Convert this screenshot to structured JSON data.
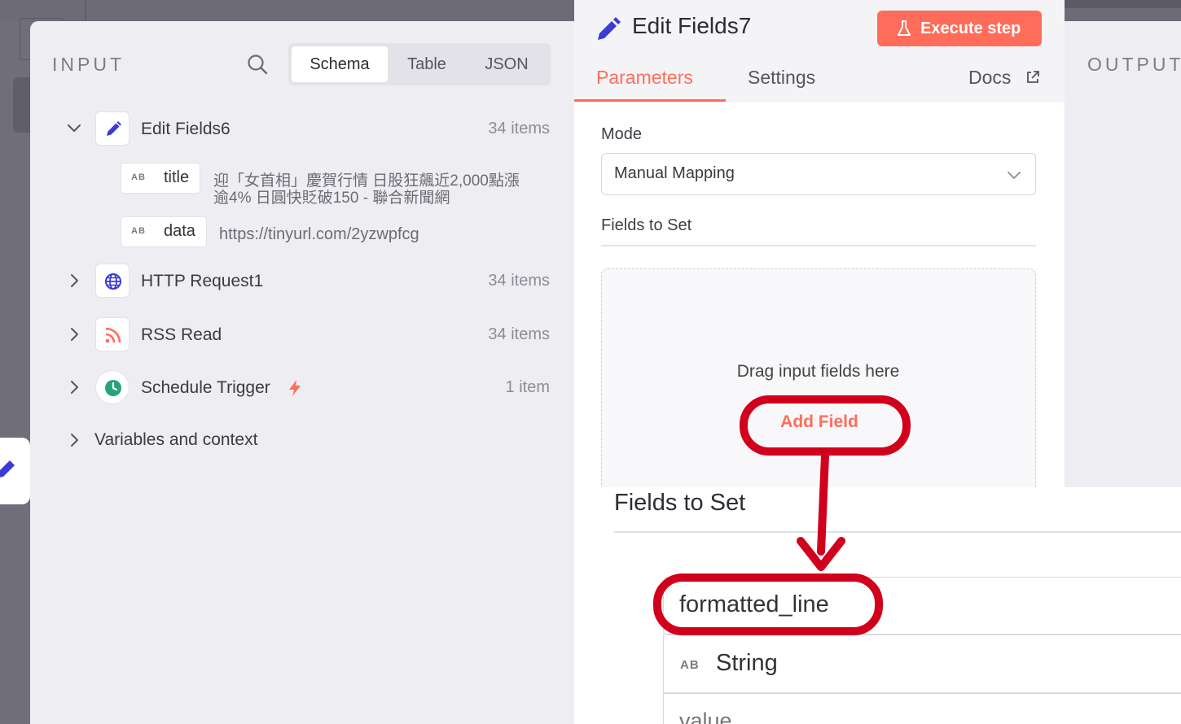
{
  "input": {
    "title": "INPUT",
    "view_tabs": [
      "Schema",
      "Table",
      "JSON"
    ],
    "active_view": "Schema",
    "nodes": [
      {
        "name": "Edit Fields6",
        "count": "34 items",
        "icon": "pencil-icon",
        "expanded": true
      },
      {
        "name": "HTTP Request1",
        "count": "34 items",
        "icon": "globe-icon",
        "expanded": false
      },
      {
        "name": "RSS Read",
        "count": "34 items",
        "icon": "rss-icon",
        "expanded": false
      },
      {
        "name": "Schedule Trigger",
        "count": "1 item",
        "icon": "clock-icon",
        "expanded": false
      }
    ],
    "fields": [
      {
        "type": "AB",
        "name": "title",
        "value_line1": "迎「女首相」慶賀行情 日股狂飆近2,000點漲",
        "value_line2": "逾4% 日圓快貶破150 - 聯合新聞網"
      },
      {
        "type": "AB",
        "name": "data",
        "value": "https://tinyurl.com/2yzwpfcg"
      }
    ],
    "variables_label": "Variables and context"
  },
  "node": {
    "title": "Edit Fields7",
    "execute_label": "Execute step",
    "tabs": [
      "Parameters",
      "Settings"
    ],
    "active_tab": "Parameters",
    "docs_label": "Docs",
    "mode_label": "Mode",
    "mode_value": "Manual Mapping",
    "fields_to_set_label": "Fields to Set",
    "drop_text": "Drag input fields here",
    "add_field_label": "Add Field"
  },
  "output": {
    "title": "OUTPUT"
  },
  "inset": {
    "title": "Fields to Set",
    "field_name": "formatted_line",
    "field_type_icon": "AB",
    "field_type": "String",
    "value_placeholder": "value"
  },
  "colors": {
    "accent": "#ff6d5a",
    "annotation": "#d1001c",
    "panel_bg": "#eeeef2",
    "canvas_bg": "#6f6e7a"
  }
}
